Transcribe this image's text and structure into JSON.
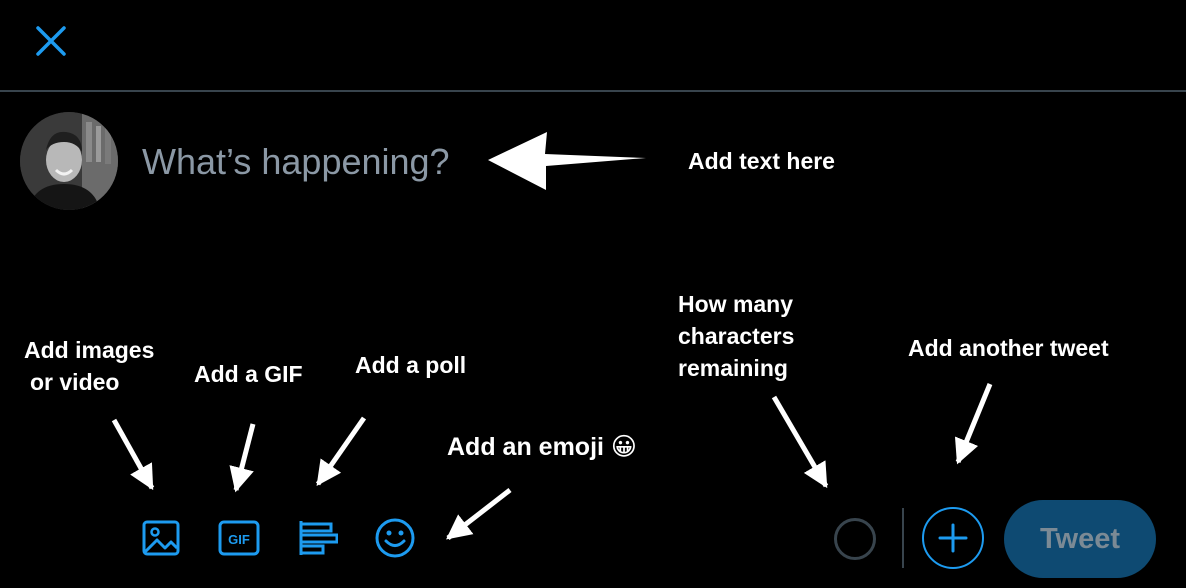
{
  "composer": {
    "placeholder": "What’s happening?",
    "tweet_label": "Tweet"
  },
  "toolbar": {
    "gif_label": "GIF"
  },
  "annotations": {
    "add_text": "Add text here",
    "add_images_line1": "Add images",
    "add_images_line2": "or video",
    "add_gif": "Add a GIF",
    "add_poll": "Add a poll",
    "add_emoji": "Add an emoji",
    "add_emoji_glyph": "😀",
    "chars_line1": "How many",
    "chars_line2": "characters",
    "chars_line3": "remaining",
    "add_another": "Add another tweet"
  },
  "colors": {
    "accent": "#1d9bf0",
    "background": "#000000",
    "divider": "#38444d",
    "tweet_button_disabled": "#0e4a72"
  },
  "icons": [
    "close-icon",
    "image-icon",
    "gif-icon",
    "poll-icon",
    "emoji-icon",
    "plus-icon"
  ]
}
